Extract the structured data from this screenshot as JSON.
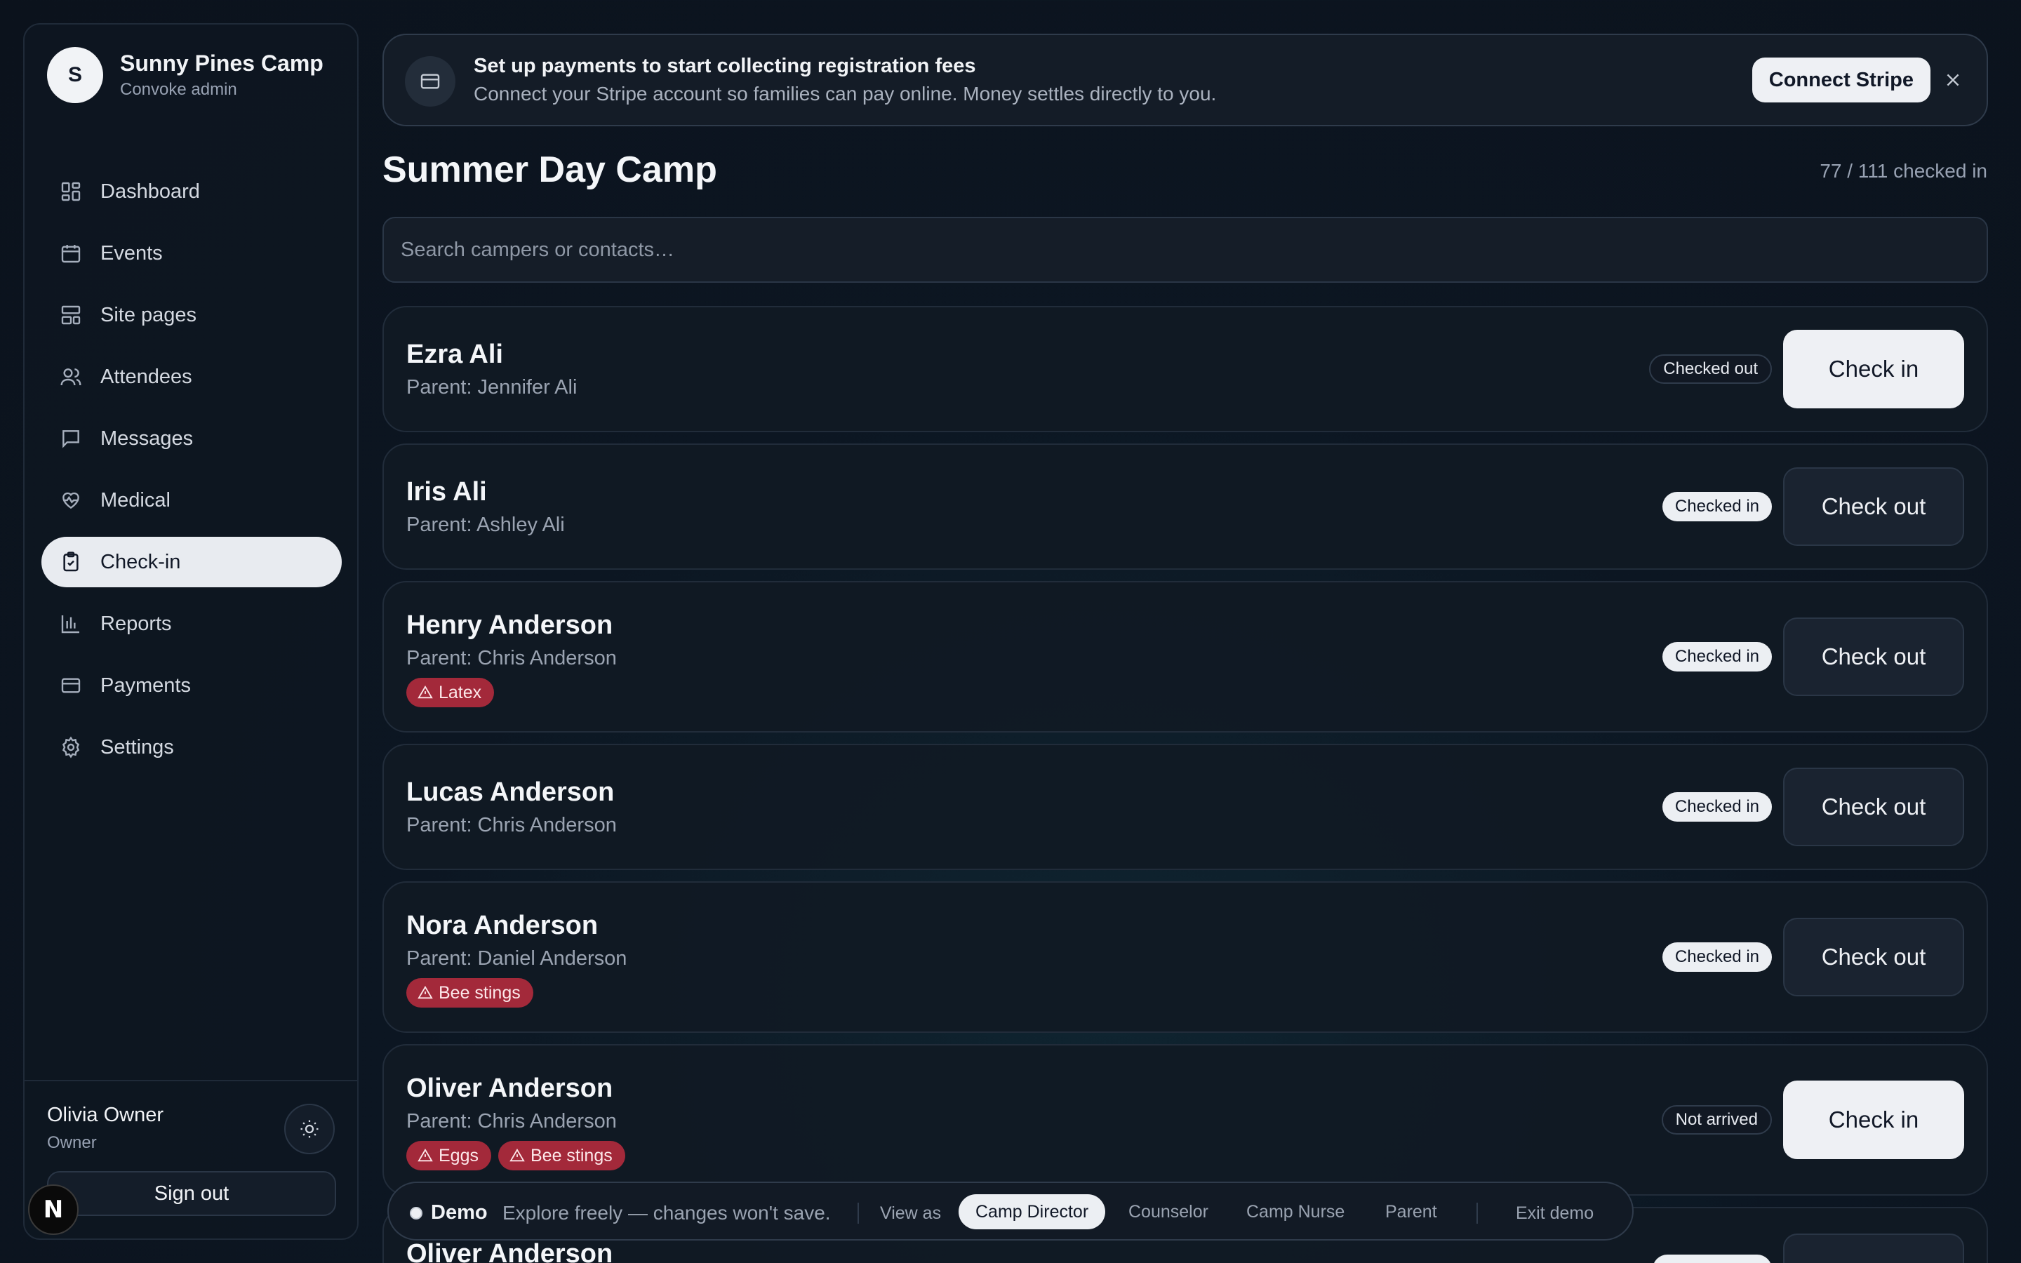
{
  "sidebar": {
    "brand": {
      "initial": "S",
      "name": "Sunny Pines Camp",
      "role": "Convoke admin"
    },
    "nav": [
      {
        "label": "Dashboard",
        "icon": "dashboard-icon"
      },
      {
        "label": "Events",
        "icon": "calendar-icon"
      },
      {
        "label": "Site pages",
        "icon": "layout-icon"
      },
      {
        "label": "Attendees",
        "icon": "users-icon"
      },
      {
        "label": "Messages",
        "icon": "message-icon"
      },
      {
        "label": "Medical",
        "icon": "heart-pulse-icon"
      },
      {
        "label": "Check-in",
        "icon": "clipboard-check-icon",
        "active": true
      },
      {
        "label": "Reports",
        "icon": "bar-chart-icon"
      },
      {
        "label": "Payments",
        "icon": "credit-card-icon"
      },
      {
        "label": "Settings",
        "icon": "gear-icon"
      }
    ],
    "user": {
      "name": "Olivia Owner",
      "role": "Owner"
    },
    "sign_out": "Sign out",
    "n_badge": "N"
  },
  "banner": {
    "title": "Set up payments to start collecting registration fees",
    "subtitle": "Connect your Stripe account so families can pay online. Money settles directly to you.",
    "button": "Connect Stripe"
  },
  "page": {
    "title": "Summer Day Camp",
    "checked_count": "77 / 111 checked in",
    "search_placeholder": "Search campers or contacts…"
  },
  "campers": [
    {
      "name": "Ezra Ali",
      "parent": "Parent: Jennifer Ali",
      "tags": [],
      "status": "Checked out",
      "status_kind": "out",
      "action": "Check in",
      "action_style": "light"
    },
    {
      "name": "Iris Ali",
      "parent": "Parent: Ashley Ali",
      "tags": [],
      "status": "Checked in",
      "status_kind": "in",
      "action": "Check out",
      "action_style": "dark"
    },
    {
      "name": "Henry Anderson",
      "parent": "Parent: Chris Anderson",
      "tags": [
        "Latex"
      ],
      "status": "Checked in",
      "status_kind": "in",
      "action": "Check out",
      "action_style": "dark"
    },
    {
      "name": "Lucas Anderson",
      "parent": "Parent: Chris Anderson",
      "tags": [],
      "status": "Checked in",
      "status_kind": "in",
      "action": "Check out",
      "action_style": "dark"
    },
    {
      "name": "Nora Anderson",
      "parent": "Parent: Daniel Anderson",
      "tags": [
        "Bee stings"
      ],
      "status": "Checked in",
      "status_kind": "in",
      "action": "Check out",
      "action_style": "dark"
    },
    {
      "name": "Oliver Anderson",
      "parent": "Parent: Chris Anderson",
      "tags": [
        "Eggs",
        "Bee stings"
      ],
      "status": "Not arrived",
      "status_kind": "out",
      "action": "Check in",
      "action_style": "light"
    },
    {
      "name": "Oliver Anderson",
      "parent": "",
      "tags": [],
      "status": "",
      "status_kind": "in",
      "action": "",
      "action_style": "dark"
    }
  ],
  "demo": {
    "label": "Demo",
    "message": "Explore freely — changes won't save.",
    "view_as": "View as",
    "roles": [
      {
        "label": "Camp Director",
        "active": true
      },
      {
        "label": "Counselor"
      },
      {
        "label": "Camp Nurse"
      },
      {
        "label": "Parent"
      }
    ],
    "exit": "Exit demo"
  }
}
